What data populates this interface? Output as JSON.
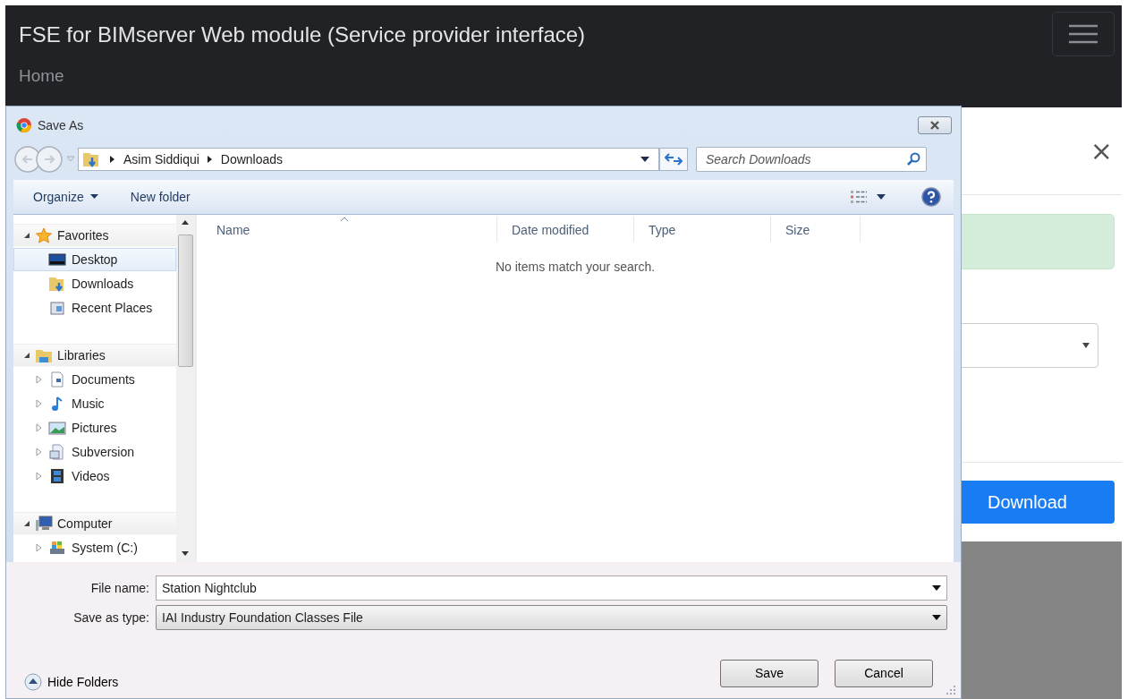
{
  "page": {
    "title": "FSE for BIMserver Web module (Service provider interface)",
    "nav": [
      "Home"
    ],
    "modal": {
      "close": "×",
      "download_button": "Download"
    }
  },
  "dialog": {
    "title": "Save As",
    "breadcrumb": [
      "Asim Siddiqui",
      "Downloads"
    ],
    "search": {
      "placeholder": "Search Downloads"
    },
    "toolbar": [
      {
        "label": "Organize",
        "kind": "menu"
      },
      {
        "label": "New folder",
        "kind": "plain"
      }
    ],
    "tree": [
      {
        "label": "Favorites",
        "kind": "star",
        "expanded": true,
        "selected": false,
        "children": [
          {
            "label": "Desktop",
            "kind": "desktop",
            "selected": true
          },
          {
            "label": "Downloads",
            "kind": "downloads",
            "selected": false
          },
          {
            "label": "Recent Places",
            "kind": "recent",
            "selected": false
          }
        ]
      },
      {
        "label": "Libraries",
        "kind": "library",
        "expanded": true,
        "selected": false,
        "children": [
          {
            "label": "Documents",
            "kind": "documents",
            "expanded": false,
            "selected": false
          },
          {
            "label": "Music",
            "kind": "music",
            "expanded": false,
            "selected": false
          },
          {
            "label": "Pictures",
            "kind": "pictures",
            "expanded": false,
            "selected": false
          },
          {
            "label": "Subversion",
            "kind": "subversion",
            "expanded": false,
            "selected": false
          },
          {
            "label": "Videos",
            "kind": "videos",
            "expanded": false,
            "selected": false
          }
        ]
      },
      {
        "label": "Computer",
        "kind": "computer",
        "expanded": true,
        "selected": false,
        "children": [
          {
            "label": "System (C:)",
            "kind": "drive",
            "expanded": false,
            "selected": false
          }
        ]
      }
    ],
    "columns": [
      "Name",
      "Date modified",
      "Type",
      "Size"
    ],
    "empty_message": "No items match your search.",
    "fields": [
      {
        "label": "File name:",
        "value": "Station Nightclub",
        "kind": "combo"
      },
      {
        "label": "Save as type:",
        "value": "IAI Industry Foundation Classes File",
        "kind": "select"
      }
    ],
    "hide_folders": "Hide Folders",
    "buttons": [
      "Save",
      "Cancel"
    ]
  }
}
